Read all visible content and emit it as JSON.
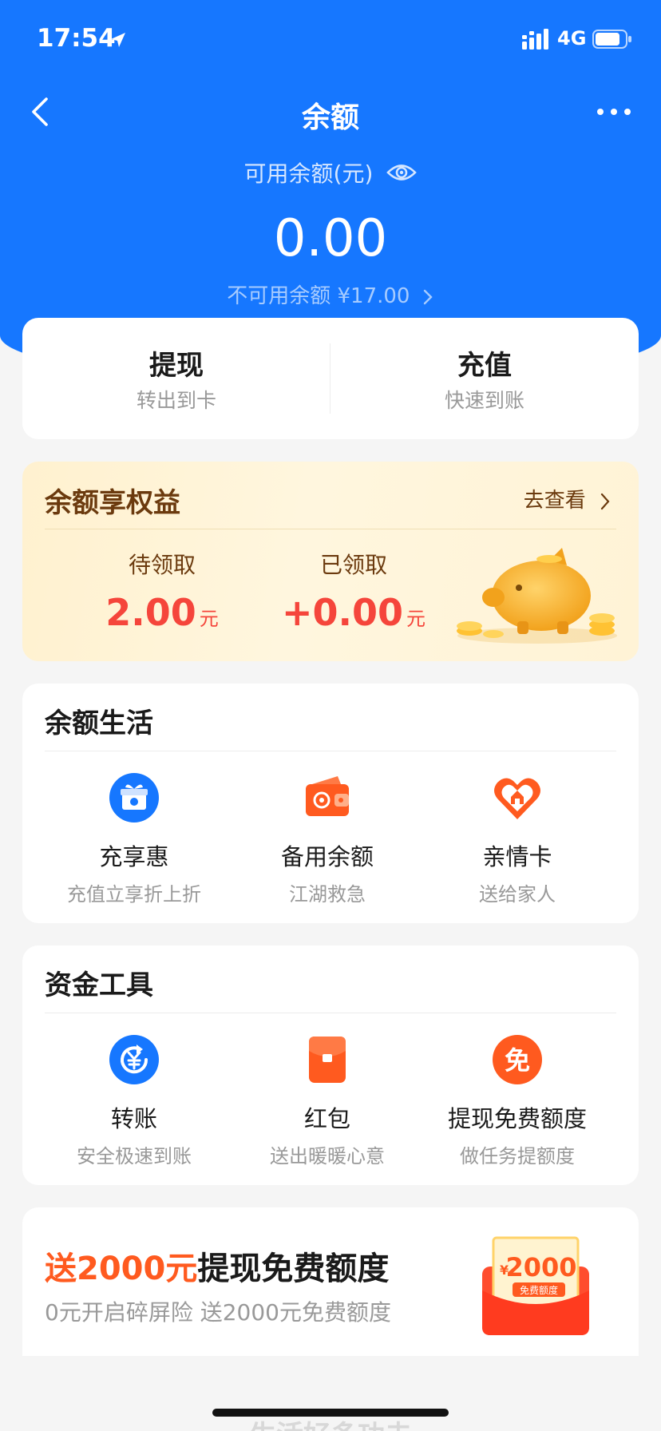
{
  "status_bar": {
    "time": "17:54",
    "network": "4G"
  },
  "header": {
    "title": "余额"
  },
  "balance": {
    "label": "可用余额(元)",
    "amount": "0.00",
    "unavailable": "不可用余额 ¥17.00"
  },
  "actions": [
    {
      "title": "提现",
      "subtitle": "转出到卡"
    },
    {
      "title": "充值",
      "subtitle": "快速到账"
    }
  ],
  "rights": {
    "title": "余额享权益",
    "link": "去查看",
    "pending_label": "待领取",
    "pending_value": "2.00",
    "claimed_label": "已领取",
    "claimed_value": "+0.00",
    "unit": "元"
  },
  "life": {
    "title": "余额生活",
    "items": [
      {
        "title": "充享惠",
        "subtitle": "充值立享折上折",
        "icon": "gift-icon"
      },
      {
        "title": "备用余额",
        "subtitle": "江湖救急",
        "icon": "wallet-icon"
      },
      {
        "title": "亲情卡",
        "subtitle": "送给家人",
        "icon": "heart-home-icon"
      }
    ]
  },
  "tools": {
    "title": "资金工具",
    "items": [
      {
        "title": "转账",
        "subtitle": "安全极速到账",
        "icon": "transfer-icon"
      },
      {
        "title": "红包",
        "subtitle": "送出暖暖心意",
        "icon": "red-packet-icon"
      },
      {
        "title": "提现免费额度",
        "subtitle": "做任务提额度",
        "icon": "free-icon",
        "icon_text": "免"
      }
    ]
  },
  "promo": {
    "highlight": "送2000元",
    "title_rest": "提现免费额度",
    "subtitle": "0元开启碎屏险 送2000元免费额度",
    "badge_currency": "¥",
    "badge_amount": "2000",
    "badge_label": "免费额度"
  },
  "peek": "生活好多功夫",
  "colors": {
    "brand_blue": "#1677ff",
    "accent_red": "#f5453b",
    "accent_orange": "#ff5a1f",
    "gold_text": "#6b3a0e"
  }
}
